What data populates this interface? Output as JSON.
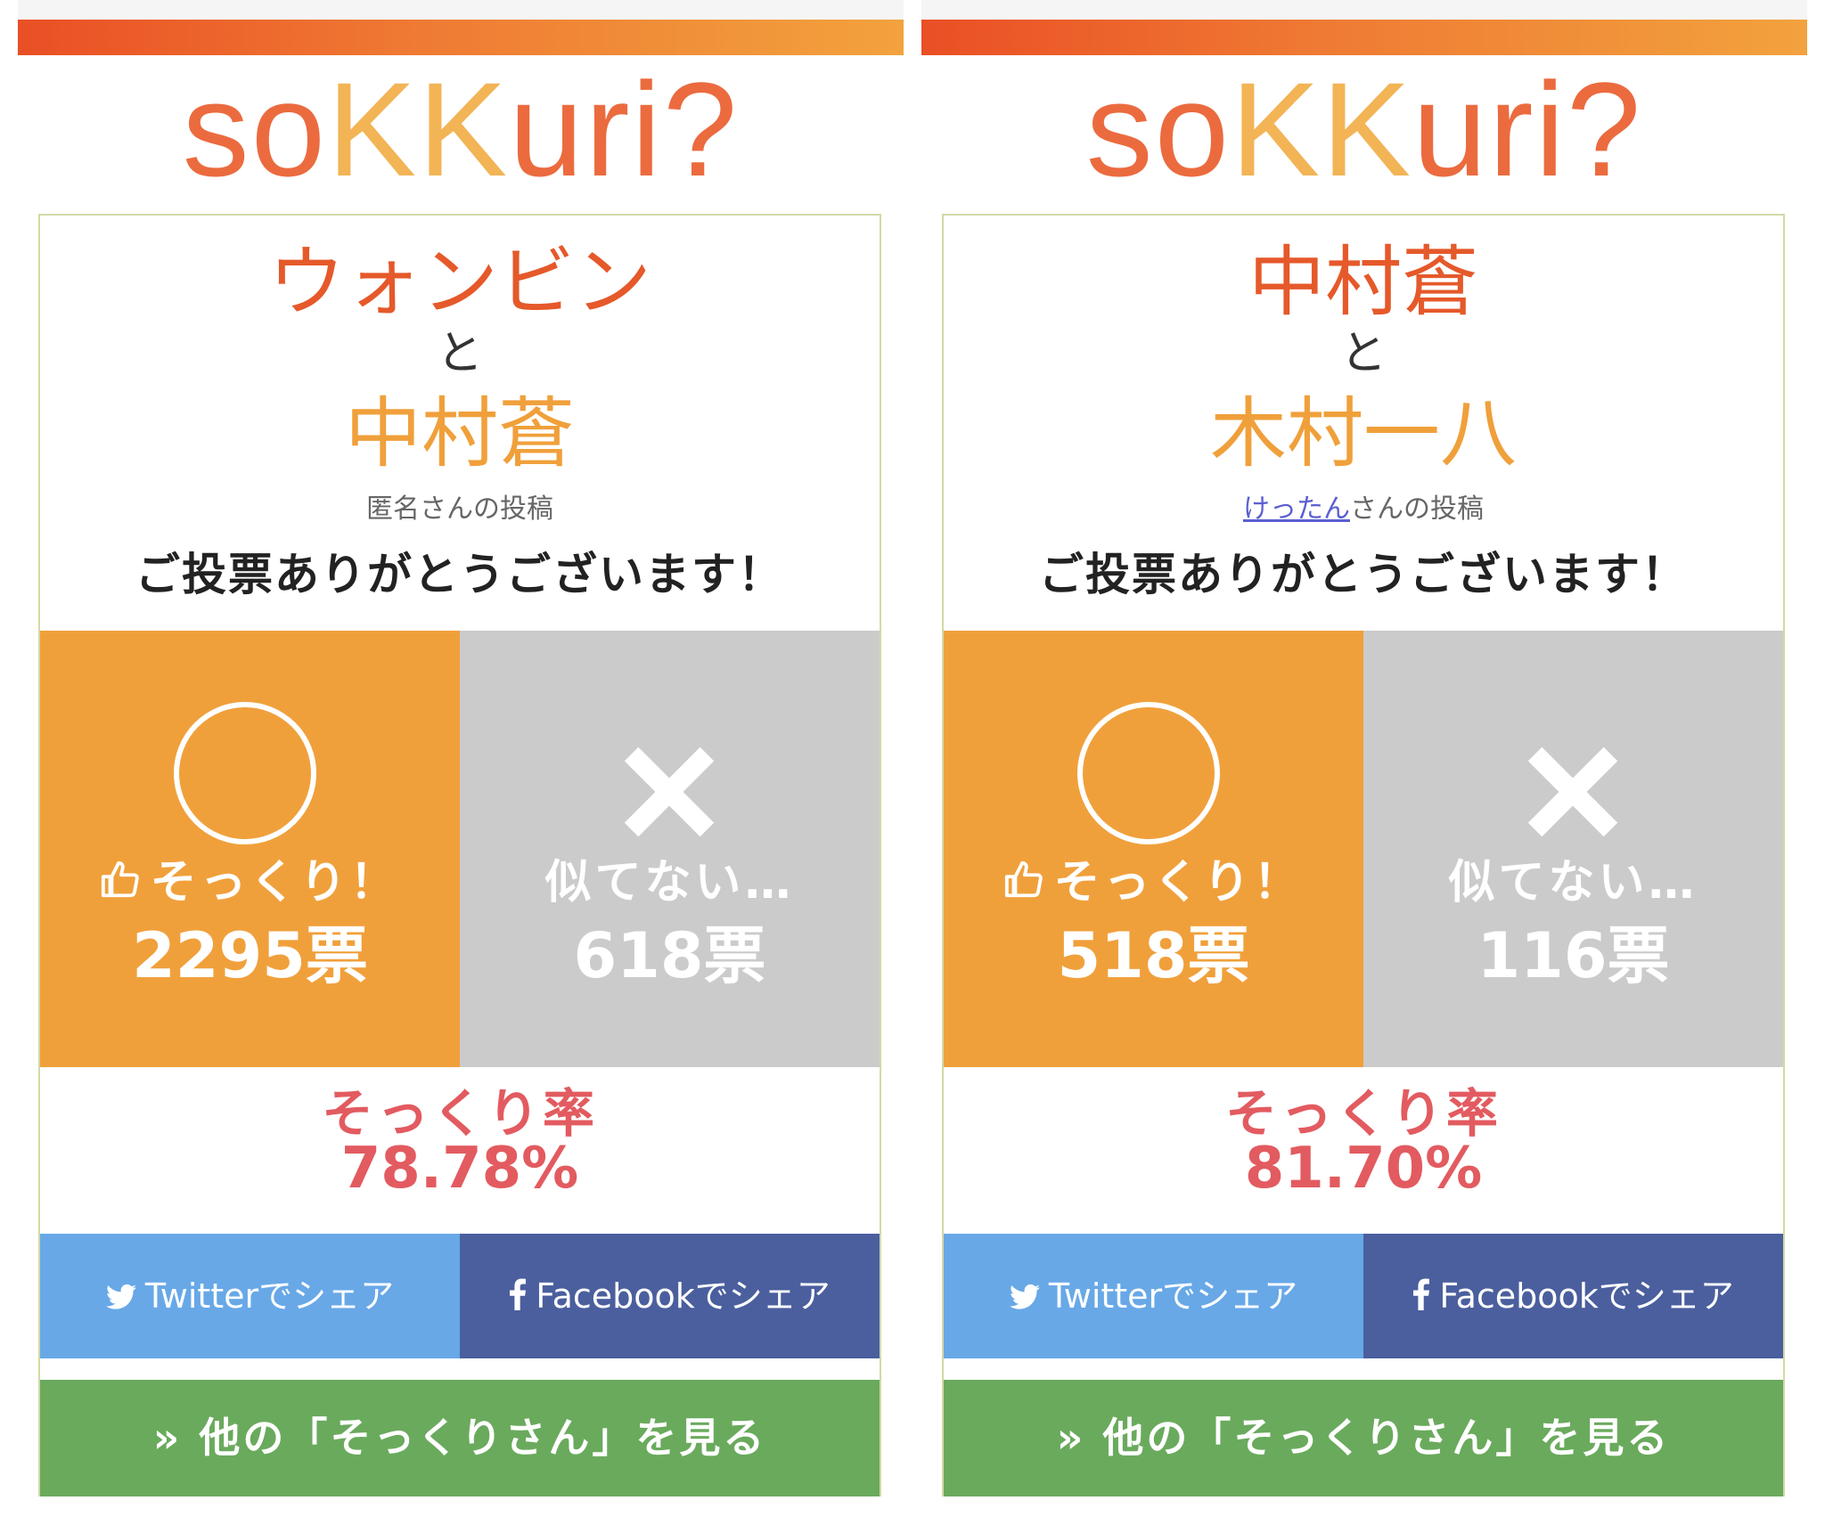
{
  "panels": [
    {
      "logo": {
        "part1": "so",
        "part2": "KK",
        "part3": "uri?"
      },
      "name1": "ウォンビン",
      "connector": "と",
      "name2": "中村蒼",
      "poster": {
        "user": "匿名",
        "suffix": "さんの投稿"
      },
      "thanks": "ご投票ありがとうございます！",
      "yes": {
        "label": "そっくり！",
        "count": "2295票"
      },
      "no": {
        "label": "似てない…",
        "count": "618票"
      },
      "rate": {
        "label": "そっくり率",
        "value": "78.78%"
      },
      "twitter_label": "Twitterでシェア",
      "facebook_label": "Facebookでシェア",
      "more_label": "» 他の「そっくりさん」を見る"
    },
    {
      "logo": {
        "part1": "so",
        "part2": "KK",
        "part3": "uri?"
      },
      "name1": "中村蒼",
      "connector": "と",
      "name2": "木村一八",
      "poster": {
        "user": "けったん",
        "suffix": "さんの投稿"
      },
      "thanks": "ご投票ありがとうございます！",
      "yes": {
        "label": "そっくり！",
        "count": "518票"
      },
      "no": {
        "label": "似てない…",
        "count": "116票"
      },
      "rate": {
        "label": "そっくり率",
        "value": "81.70%"
      },
      "twitter_label": "Twitterでシェア",
      "facebook_label": "Facebookでシェア",
      "more_label": "» 他の「そっくりさん」を見る"
    }
  ],
  "colors": {
    "header_gradient_start": "#ea4f25",
    "header_gradient_end": "#f2a23e",
    "name1": "#e5592a",
    "name2": "#f0a03b",
    "yes_bg": "#f0a03b",
    "no_bg": "#cbcbcb",
    "rate_text": "#e25b60",
    "twitter": "#68a8e7",
    "facebook": "#4b5f9e",
    "more": "#6aaa5d"
  },
  "icons": {
    "thumb": "thumbs-up-icon",
    "circle": "circle-icon",
    "cross": "cross-icon",
    "twitter": "twitter-bird-icon",
    "facebook": "facebook-f-icon"
  }
}
